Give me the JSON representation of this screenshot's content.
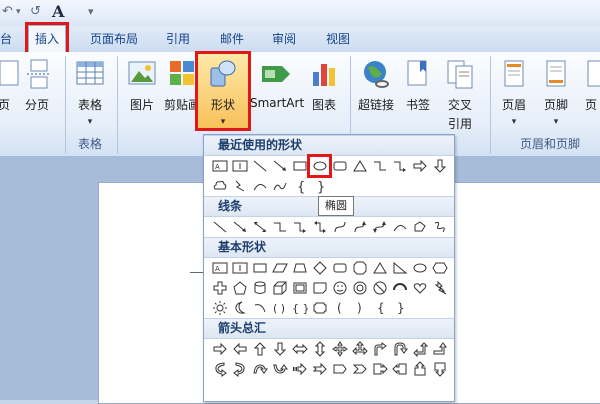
{
  "qat": {
    "undo": "↶",
    "redo": "↺",
    "font_a": "A",
    "customize": "▾"
  },
  "tabs": [
    {
      "label": "台"
    },
    {
      "label": "插入"
    },
    {
      "label": "页面布局"
    },
    {
      "label": "引用"
    },
    {
      "label": "邮件"
    },
    {
      "label": "审阅"
    },
    {
      "label": "视图"
    }
  ],
  "ribbon": {
    "buttons": {
      "page": "页",
      "page_break": "分页",
      "table": "表格",
      "picture": "图片",
      "clipart": "剪贴画",
      "shapes": "形状",
      "smartart": "SmartArt",
      "chart": "图表",
      "hyperlink": "超链接",
      "bookmark": "书签",
      "crossref_1": "交叉",
      "crossref_2": "引用",
      "header": "页眉",
      "footer": "页脚",
      "page_number": "页"
    },
    "groups": {
      "tables": "表格",
      "header_footer": "页眉和页脚"
    }
  },
  "gallery": {
    "sections": {
      "recent": "最近使用的形状",
      "lines": "线条",
      "basic": "基本形状",
      "arrows": "箭头总汇"
    },
    "tooltip": "椭圆"
  },
  "colors": {
    "highlight": "#e01818",
    "ribbon_text": "#15428b"
  }
}
